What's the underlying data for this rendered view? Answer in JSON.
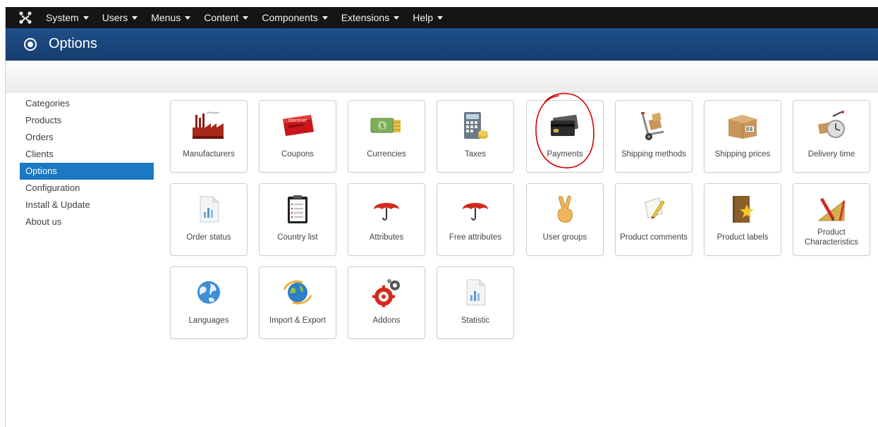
{
  "navbar": {
    "logo_icon": "joomla-logo-icon",
    "menu": [
      {
        "label": "System"
      },
      {
        "label": "Users"
      },
      {
        "label": "Menus"
      },
      {
        "label": "Content"
      },
      {
        "label": "Components"
      },
      {
        "label": "Extensions"
      },
      {
        "label": "Help"
      }
    ]
  },
  "header": {
    "icon": "radio-circle-icon",
    "title": "Options"
  },
  "sidebar": {
    "items": [
      {
        "label": "Categories",
        "active": false
      },
      {
        "label": "Products",
        "active": false
      },
      {
        "label": "Orders",
        "active": false
      },
      {
        "label": "Clients",
        "active": false
      },
      {
        "label": "Options",
        "active": true
      },
      {
        "label": "Configuration",
        "active": false
      },
      {
        "label": "Install & Update",
        "active": false
      },
      {
        "label": "About us",
        "active": false
      }
    ]
  },
  "tiles": [
    {
      "label": "Manufacturers",
      "icon": "factory-icon"
    },
    {
      "label": "Coupons",
      "icon": "discount-ticket-icon"
    },
    {
      "label": "Currencies",
      "icon": "money-icon"
    },
    {
      "label": "Taxes",
      "icon": "calculator-icon"
    },
    {
      "label": "Payments",
      "icon": "credit-card-icon"
    },
    {
      "label": "Shipping methods",
      "icon": "hand-truck-icon"
    },
    {
      "label": "Shipping prices",
      "icon": "parcel-box-icon"
    },
    {
      "label": "Delivery time",
      "icon": "stopwatch-icon"
    },
    {
      "label": "Order status",
      "icon": "document-chart-icon"
    },
    {
      "label": "Country list",
      "icon": "clipboard-list-icon"
    },
    {
      "label": "Attributes",
      "icon": "umbrella-icon"
    },
    {
      "label": "Free attributes",
      "icon": "umbrella-icon"
    },
    {
      "label": "User groups",
      "icon": "victory-hand-icon"
    },
    {
      "label": "Product comments",
      "icon": "note-pencil-icon"
    },
    {
      "label": "Product labels",
      "icon": "book-star-icon"
    },
    {
      "label": "Product Characteristics",
      "icon": "ruler-pencil-icon"
    },
    {
      "label": "Languages",
      "icon": "globe-icon"
    },
    {
      "label": "Import & Export",
      "icon": "globe-arrows-icon"
    },
    {
      "label": "Addons",
      "icon": "gears-icon"
    },
    {
      "label": "Statistic",
      "icon": "document-chart-icon"
    }
  ],
  "colors": {
    "navbar_bg": "#151515",
    "header_bg": "#1f4f8a",
    "sidebar_active": "#1b79c4",
    "annotation_red": "#d40000"
  },
  "annotation": {
    "type": "hand-drawn-circle",
    "target": "Payments"
  }
}
